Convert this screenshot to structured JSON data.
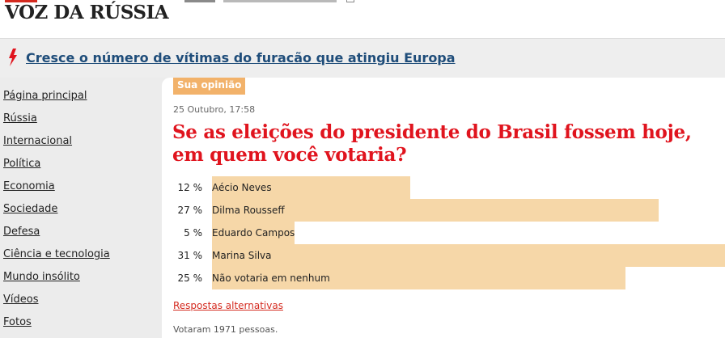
{
  "header": {
    "logo": "VOZ DA RÚSSIA"
  },
  "breaking": {
    "icon": "lightning-bolt-icon",
    "headline": "Cresce o número de vítimas do furacão que atingiu Europa"
  },
  "sidebar": {
    "items": [
      {
        "label": "Página principal"
      },
      {
        "label": "Rússia"
      },
      {
        "label": "Internacional"
      },
      {
        "label": "Política"
      },
      {
        "label": "Economia"
      },
      {
        "label": "Sociedade"
      },
      {
        "label": "Defesa"
      },
      {
        "label": "Ciência e tecnologia"
      },
      {
        "label": "Mundo insólito"
      },
      {
        "label": "Vídeos"
      },
      {
        "label": "Fotos"
      }
    ]
  },
  "article": {
    "section_badge": "Sua opinião",
    "date": "25 Outubro, 17:58",
    "title": "Se as eleições do presidente do Brasil fossem hoje, em quem você votaria?"
  },
  "poll": {
    "bar_color": "#f6d7a8",
    "options": [
      {
        "percent_label": "12 %",
        "percent": 12,
        "label": "Aécio Neves"
      },
      {
        "percent_label": "27 %",
        "percent": 27,
        "label": "Dilma Rousseff"
      },
      {
        "percent_label": "5 %",
        "percent": 5,
        "label": "Eduardo Campos"
      },
      {
        "percent_label": "31 %",
        "percent": 31,
        "label": "Marina Silva"
      },
      {
        "percent_label": "25 %",
        "percent": 25,
        "label": "Não votaria em nenhum"
      }
    ],
    "alt_link": "Respostas alternativas",
    "votes_text": "Votaram 1971 pessoas."
  },
  "colors": {
    "headline_red": "#e0141e",
    "badge_orange": "#f2b26a",
    "link_blue": "#1f4d7a"
  }
}
